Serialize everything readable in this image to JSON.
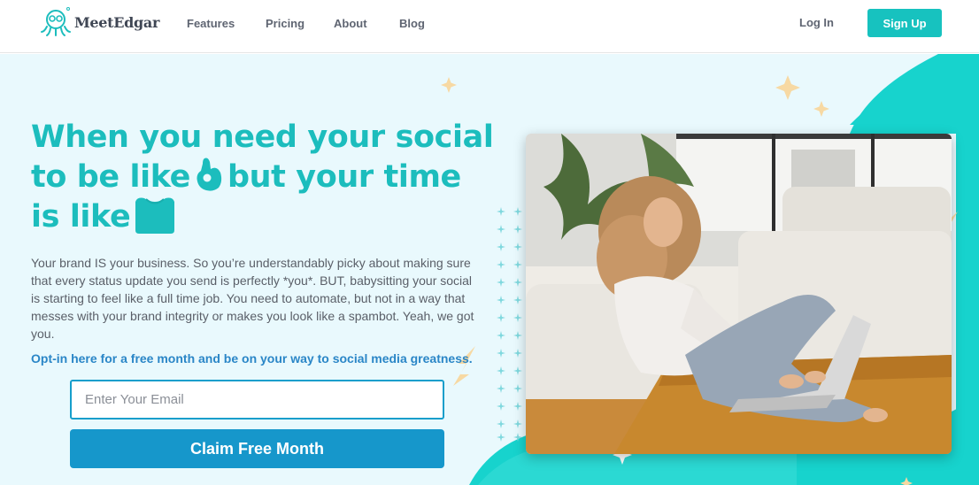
{
  "header": {
    "logo_text": "MeetEdgar",
    "nav": [
      {
        "label": "Features"
      },
      {
        "label": "Pricing"
      },
      {
        "label": "About"
      },
      {
        "label": "Blog"
      }
    ],
    "login_label": "Log In",
    "signup_label": "Sign Up"
  },
  "hero": {
    "headline": {
      "line1": "When you need your social",
      "line2_start": "to be like",
      "line2_end": "but your time",
      "line3_start": "is like"
    },
    "emoji": {
      "first": "ok-hand-icon",
      "second": "shirt-icon"
    },
    "body": "Your brand IS your business. So you’re understandably picky about making sure that every status update you send is perfectly *you*.  BUT, babysitting your social is starting to feel like a full time job. You need to automate, but not in a way that messes with your brand integrity or makes you look like a spambot. Yeah, we got you.",
    "optin": "Opt-in here for a free month and be on your way to social media greatness.",
    "email_placeholder": "Enter Your Email",
    "cta_label": "Claim Free Month"
  },
  "colors": {
    "teal": "#1cbdbd",
    "button_blue": "#1697cb",
    "link_blue": "#2a86c7",
    "hero_bg": "#e9f9fd",
    "accent_star": "#f7d9a3"
  }
}
